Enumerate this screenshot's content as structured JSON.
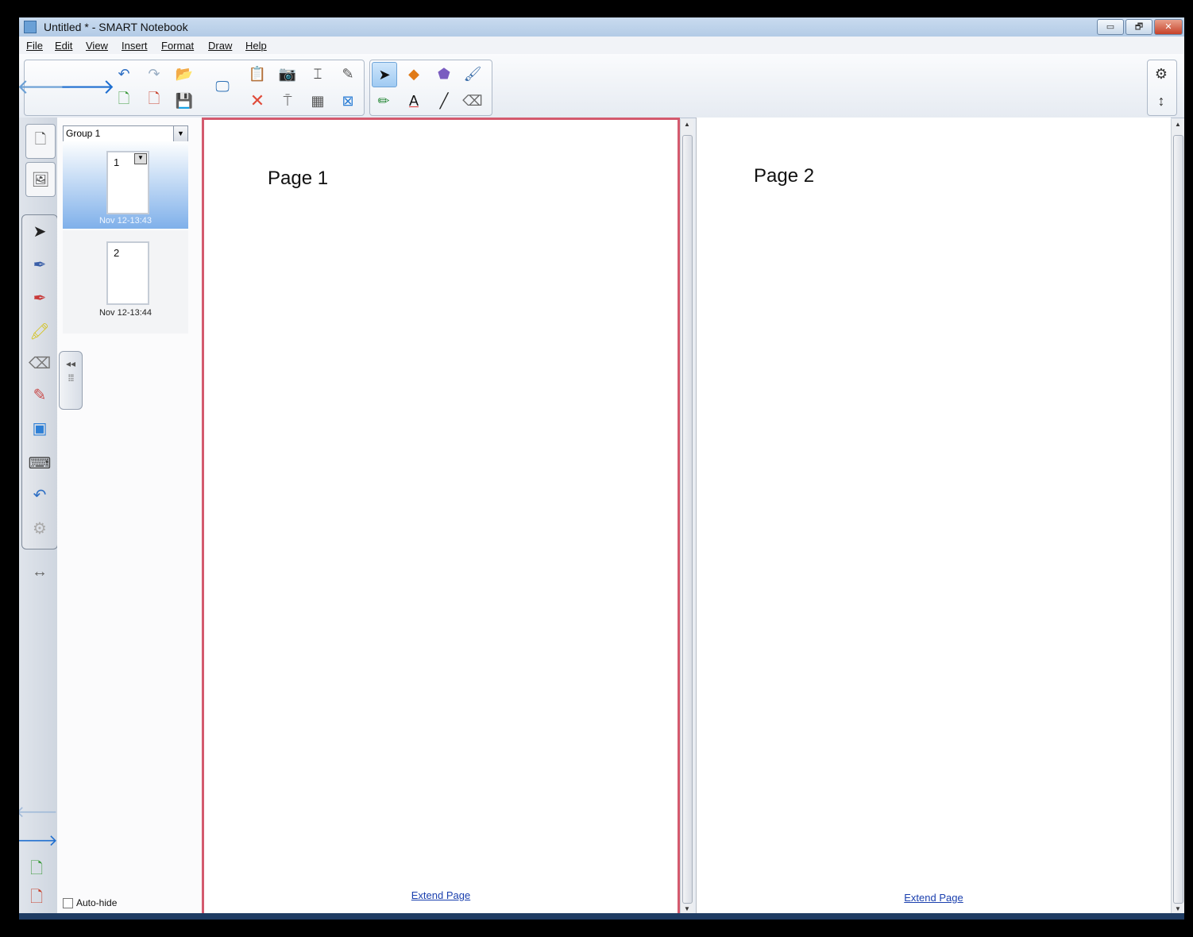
{
  "window": {
    "title": "Untitled * - SMART Notebook",
    "buttons": {
      "minimize": "▭",
      "restore": "🗗",
      "close": "✕"
    }
  },
  "menu": [
    "File",
    "Edit",
    "View",
    "Insert",
    "Format",
    "Draw",
    "Help"
  ],
  "toolbar": {
    "icons": {
      "back": "arrow-left-icon",
      "forward": "arrow-right-icon",
      "undo": "undo-icon",
      "redo": "redo-icon",
      "open": "folder-open-icon",
      "add_page": "add-page-icon",
      "delete_page": "delete-page-icon",
      "save": "save-icon",
      "display": "display-screen-icon",
      "paste": "paste-icon",
      "delete": "delete-icon",
      "screen_capture": "screen-capture-icon",
      "screen_shade": "screen-shade-icon",
      "insert_text": "insert-text-icon",
      "table": "table-icon",
      "spelling": "spell-check-icon",
      "fullscreen": "fullscreen-icon",
      "select": "select-pointer-icon",
      "pens": "pens-icon",
      "shapes": "shapes-icon",
      "text": "text-tool-icon",
      "magic_pen": "magic-pen-icon",
      "line": "line-icon",
      "fill": "fill-icon",
      "eraser": "eraser-icon",
      "settings": "gear-icon",
      "move_toolbar": "move-toolbar-icon"
    }
  },
  "sorter": {
    "group_label": "Group 1",
    "pages": [
      {
        "number": "1",
        "date": "Nov 12-13:43",
        "selected": true
      },
      {
        "number": "2",
        "date": "Nov 12-13:44",
        "selected": false
      }
    ],
    "autohide_label": "Auto-hide"
  },
  "pages": [
    {
      "title": "Page 1",
      "extend": "Extend Page"
    },
    {
      "title": "Page 2",
      "extend": "Extend Page"
    }
  ],
  "colors": {
    "accent": "#2d7fd6",
    "selected_page_border": "#d45a6e",
    "link": "#1a3fae"
  }
}
